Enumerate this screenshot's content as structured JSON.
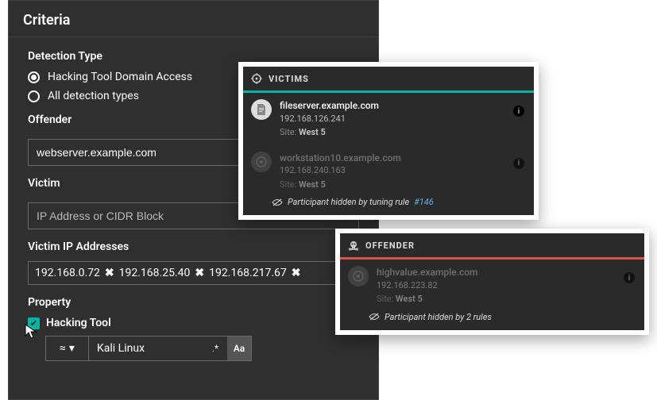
{
  "criteria": {
    "title": "Criteria",
    "detection_type_label": "Detection Type",
    "radio_options": [
      {
        "label": "Hacking Tool Domain Access",
        "selected": true
      },
      {
        "label": "All detection types",
        "selected": false
      }
    ],
    "offender_label": "Offender",
    "offender_value": "webserver.example.com",
    "victim_label": "Victim",
    "victim_placeholder": "IP Address or CIDR Block",
    "victim_ips_label": "Victim IP Addresses",
    "victim_ip_tags": [
      "192.168.0.72",
      "192.168.25.40",
      "192.168.217.67"
    ],
    "property_label": "Property",
    "property_checkbox_label": "Hacking Tool",
    "property_operator": "≈",
    "property_value": "Kali Linux",
    "regex_hint": ".*",
    "case_hint": "Aa"
  },
  "victims_card": {
    "header": "VICTIMS",
    "entities": [
      {
        "name": "fileserver.example.com",
        "ip": "192.168.126.241",
        "site_label": "Site:",
        "site_value": "West 5",
        "hidden": false
      },
      {
        "name": "workstation10.example.com",
        "ip": "192.168.240.163",
        "site_label": "Site:",
        "site_value": "West 5",
        "hidden": true,
        "hidden_text": "Participant hidden by tuning rule ",
        "hidden_rule": "#146"
      }
    ]
  },
  "offender_card": {
    "header": "OFFENDER",
    "entity": {
      "name": "highvalue.example.com",
      "ip": "192.168.223.82",
      "site_label": "Site:",
      "site_value": "West 5",
      "hidden_text": "Participant hidden by 2 rules"
    }
  }
}
